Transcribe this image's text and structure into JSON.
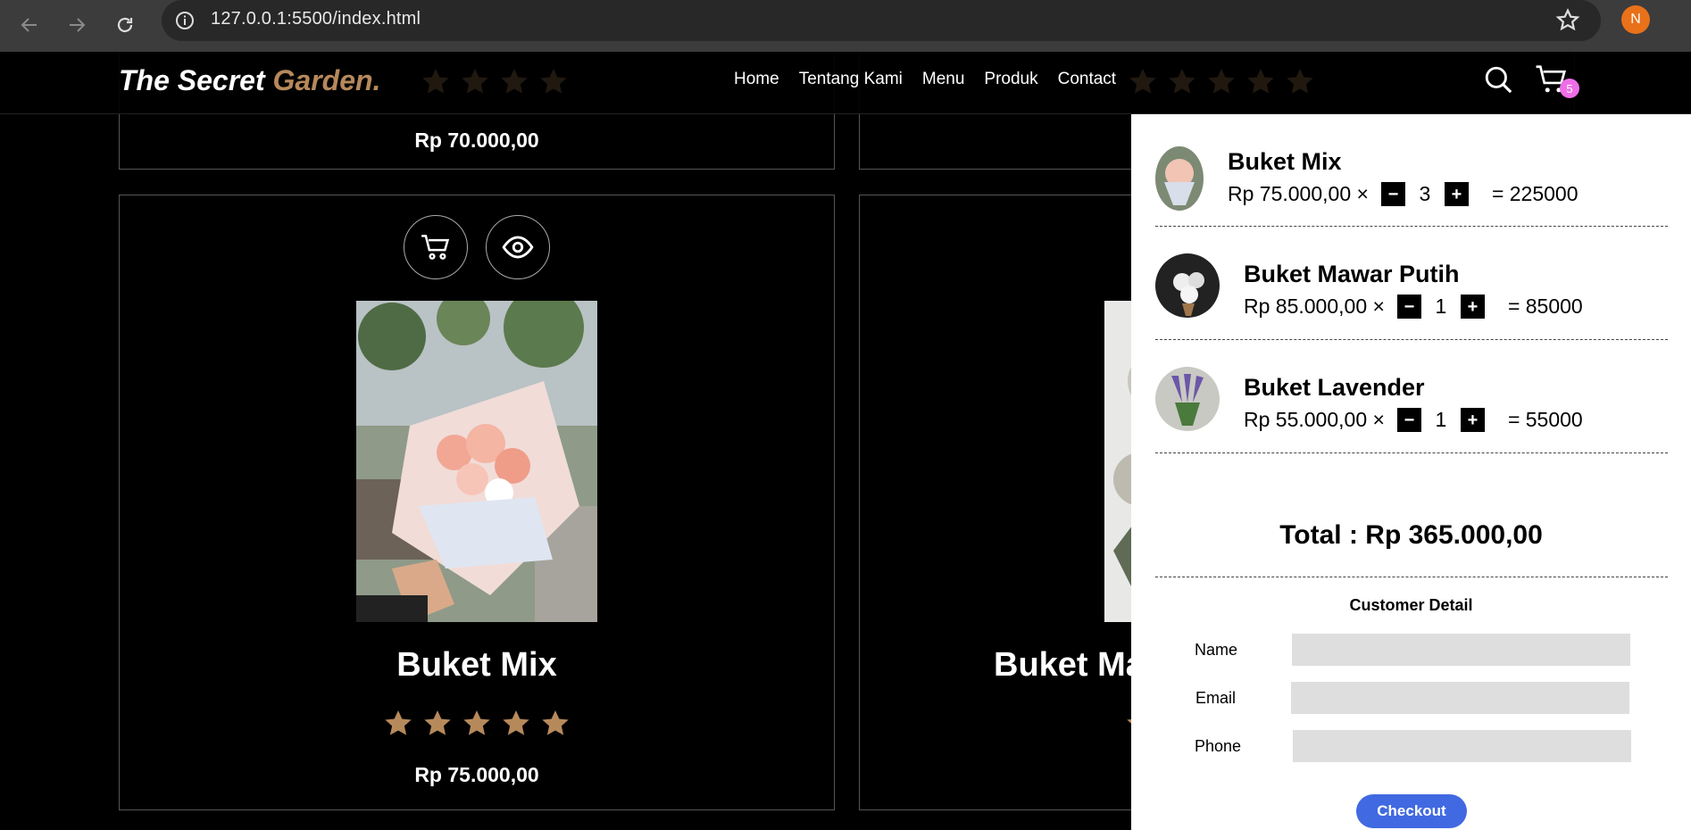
{
  "browser": {
    "url": "127.0.0.1:5500/index.html",
    "profile_initial": "N"
  },
  "header": {
    "logo_main": "The Secret ",
    "logo_accent": "Garden.",
    "nav": [
      "Home",
      "Tentang Kami",
      "Menu",
      "Produk",
      "Contact"
    ],
    "cart_count": "5"
  },
  "products": {
    "top_left_price": "Rp 70.000,00",
    "main_title": "Buket Mix",
    "main_price": "Rp 75.000,00",
    "right_title_partial": "Buket Ma",
    "rating": 5
  },
  "cart": {
    "items": [
      {
        "name": "Buket Mix",
        "unit": "Rp 75.000,00 ×",
        "qty": "3",
        "subtotal": "= 225000"
      },
      {
        "name": "Buket Mawar Putih",
        "unit": "Rp 85.000,00 ×",
        "qty": "1",
        "subtotal": "= 85000"
      },
      {
        "name": "Buket Lavender",
        "unit": "Rp 55.000,00 ×",
        "qty": "1",
        "subtotal": "= 55000"
      }
    ],
    "minus_label": "−",
    "plus_label": "+",
    "total": "Total : Rp 365.000,00",
    "customer_detail_title": "Customer Detail",
    "fields": {
      "name_label": "Name",
      "email_label": "Email",
      "phone_label": "Phone"
    },
    "checkout_label": "Checkout"
  },
  "colors": {
    "accent": "#b6895b",
    "badge": "#ee6ee8",
    "checkout": "#4169e1"
  }
}
